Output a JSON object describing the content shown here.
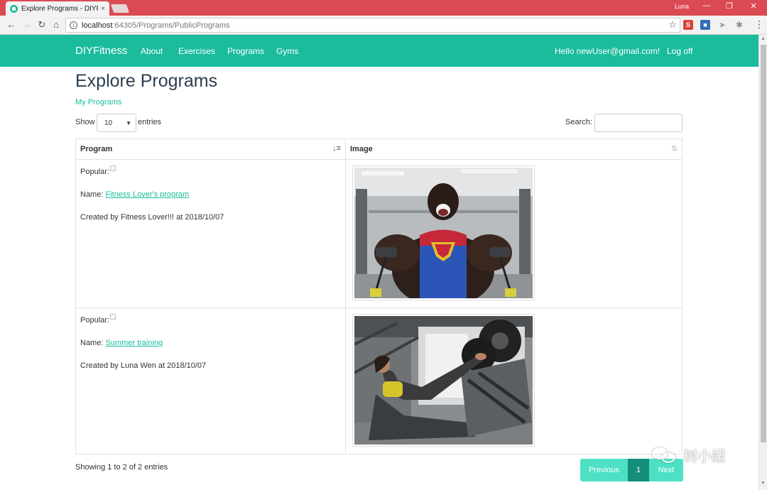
{
  "browser": {
    "tab_title": "Explore Programs - DIYFi",
    "tab_close": "×",
    "profile": "Luna",
    "url_host": "localhost",
    "url_rest": ":64305/Programs/PublicPrograms",
    "info_glyph": "i",
    "star_glyph": "☆",
    "back_glyph": "←",
    "forward_glyph": "→",
    "reload_glyph": "↻",
    "home_glyph": "⌂",
    "menu_glyph": "⋮",
    "min_glyph": "—",
    "max_glyph": "❐",
    "close_glyph": "✕",
    "extensions": [
      {
        "name": "s-extension-icon",
        "glyph": "S",
        "color": "#d9443b"
      },
      {
        "name": "blue-extension-icon",
        "glyph": "■",
        "color": "#2f6fb5"
      },
      {
        "name": "send-extension-icon",
        "glyph": "➤",
        "color": "#9aa0a6"
      },
      {
        "name": "bug-extension-icon",
        "glyph": "✱",
        "color": "#8a8f96"
      }
    ]
  },
  "nav": {
    "brand": "DIYFitness",
    "links": [
      "About",
      "Exercises",
      "Programs",
      "Gyms"
    ],
    "greeting": "Hello newUser@gmail.com!",
    "logoff": "Log off",
    "accent": "#1abc9c"
  },
  "page": {
    "title": "Explore Programs",
    "my_programs": "My Programs",
    "show": "Show",
    "page_size": "10",
    "entries": "entries",
    "search_label": "Search:",
    "search_value": ""
  },
  "table": {
    "headers": [
      "Program",
      "Image"
    ],
    "sort_active": "↓≡",
    "sort_both": "⇅",
    "rows": [
      {
        "popular_label": "Popular:",
        "name_label": "Name:",
        "name": "Fitness Lover's program",
        "created": "Created by Fitness Lover!!! at 2018/10/07"
      },
      {
        "popular_label": "Popular:",
        "name_label": "Name:",
        "name": "Summer training",
        "created": "Created by Luna Wen at 2018/10/07"
      }
    ]
  },
  "footer": {
    "showing": "Showing 1 to 2 of 2 entries",
    "previous": "Previous",
    "current_page": "1",
    "next": "Next"
  },
  "watermark": "树小妞"
}
